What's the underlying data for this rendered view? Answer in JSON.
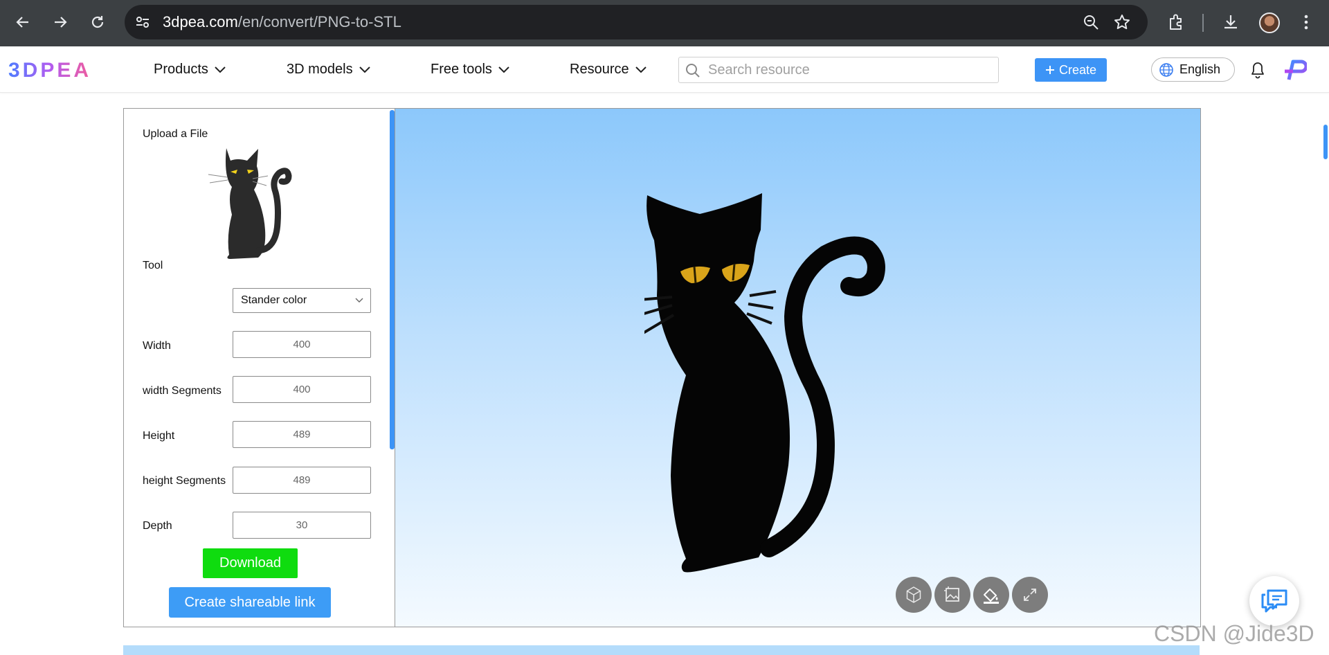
{
  "browser": {
    "url_host": "3dpea.com",
    "url_path": "/en/convert/PNG-to-STL"
  },
  "navbar": {
    "logo": "3DPEA",
    "menu": [
      {
        "label": "Products"
      },
      {
        "label": "3D models"
      },
      {
        "label": "Free tools"
      },
      {
        "label": "Resource"
      }
    ],
    "search_placeholder": "Search resource",
    "create_label": "Create",
    "language_label": "English"
  },
  "panel": {
    "upload_label": "Upload a File",
    "tool_label": "Tool",
    "tool_value": "Stander color",
    "fields": [
      {
        "label": "Width",
        "value": "400"
      },
      {
        "label": "width Segments",
        "value": "400"
      },
      {
        "label": "Height",
        "value": "489"
      },
      {
        "label": "height Segments",
        "value": "489"
      },
      {
        "label": "Depth",
        "value": "30"
      }
    ],
    "download_label": "Download",
    "share_label": "Create shareable link"
  },
  "viewer": {
    "tools": [
      "wireframe-icon",
      "image-icon",
      "paint-bucket-icon",
      "expand-icon"
    ]
  },
  "watermark": "CSDN @Jide3D",
  "colors": {
    "accent_blue": "#3d94f6",
    "download_green": "#0fdc0f",
    "chrome_dark": "#3c4043"
  }
}
